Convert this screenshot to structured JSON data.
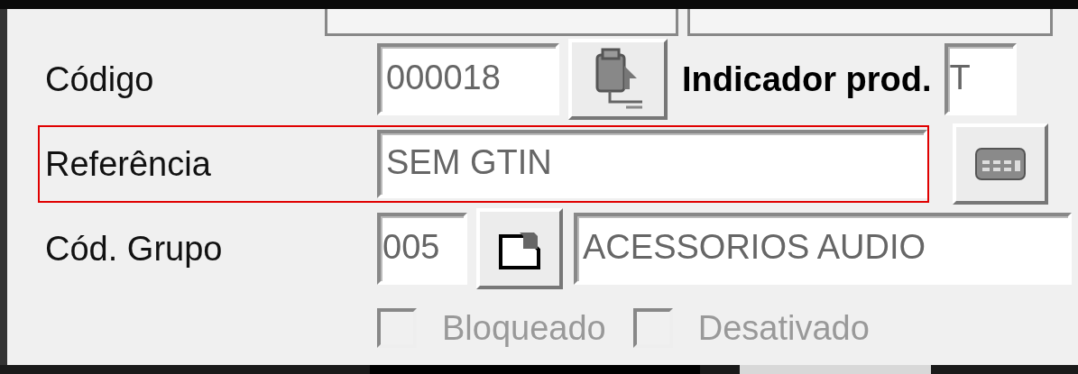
{
  "form": {
    "rows": [
      {
        "kind": "code",
        "label": "Código",
        "field": "000018",
        "highlighted": false,
        "extra_label": "Indicador prod.",
        "extra_field": "T"
      },
      {
        "kind": "reference",
        "label": "Referência",
        "field": "SEM GTIN",
        "highlighted": true
      },
      {
        "kind": "group",
        "label": "Cód. Grupo",
        "field": "005",
        "group_name": "ACESSORIOS AUDIO",
        "highlighted": false
      }
    ],
    "checkboxes": [
      {
        "label": "Bloqueado",
        "checked": false,
        "disabled": true
      },
      {
        "label": "Desativado",
        "checked": false,
        "disabled": true
      }
    ]
  }
}
